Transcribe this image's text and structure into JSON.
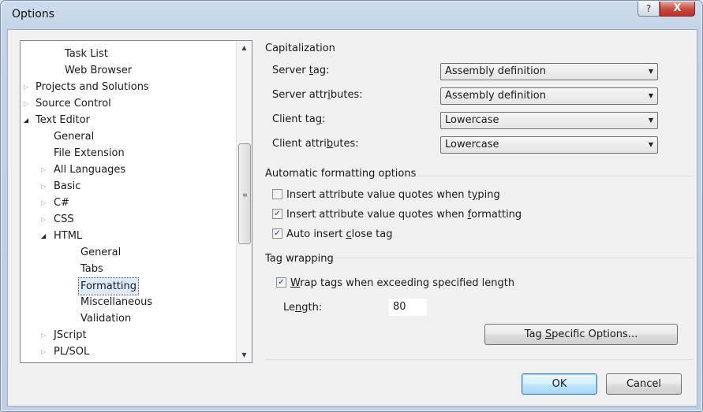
{
  "window": {
    "title": "Options",
    "help_label": "?",
    "close_label": "X"
  },
  "tree": {
    "items": [
      {
        "label": "Task List",
        "level": 2,
        "expander": ""
      },
      {
        "label": "Web Browser",
        "level": 2,
        "expander": ""
      },
      {
        "label": "Projects and Solutions",
        "level": 0,
        "expander": "collapsed"
      },
      {
        "label": "Source Control",
        "level": 0,
        "expander": "collapsed"
      },
      {
        "label": "Text Editor",
        "level": 0,
        "expander": "expanded"
      },
      {
        "label": "General",
        "level": 1,
        "expander": ""
      },
      {
        "label": "File Extension",
        "level": 1,
        "expander": ""
      },
      {
        "label": "All Languages",
        "level": 1,
        "expander": "collapsed"
      },
      {
        "label": "Basic",
        "level": 1,
        "expander": "collapsed"
      },
      {
        "label": "C#",
        "level": 1,
        "expander": "collapsed"
      },
      {
        "label": "CSS",
        "level": 1,
        "expander": "collapsed"
      },
      {
        "label": "HTML",
        "level": 1,
        "expander": "expanded"
      },
      {
        "label": "General",
        "level": 2,
        "expander": ""
      },
      {
        "label": "Tabs",
        "level": 2,
        "expander": ""
      },
      {
        "label": "Formatting",
        "level": 2,
        "expander": "",
        "selected": true
      },
      {
        "label": "Miscellaneous",
        "level": 2,
        "expander": ""
      },
      {
        "label": "Validation",
        "level": 2,
        "expander": ""
      },
      {
        "label": "JScript",
        "level": 1,
        "expander": "collapsed"
      },
      {
        "label": "PL/SOL",
        "level": 1,
        "expander": "collapsed"
      }
    ]
  },
  "capitalization": {
    "title": "Capitalization",
    "rows": [
      {
        "label_pre": "Server ",
        "label_u": "t",
        "label_post": "ag:",
        "value": "Assembly definition"
      },
      {
        "label_pre": "Server attr",
        "label_u": "i",
        "label_post": "butes:",
        "value": "Assembly definition"
      },
      {
        "label_pre": "Client ta",
        "label_u": "g",
        "label_post": ":",
        "value": "Lowercase"
      },
      {
        "label_pre": "Client attri",
        "label_u": "b",
        "label_post": "utes:",
        "value": "Lowercase"
      }
    ]
  },
  "auto_format": {
    "title": "Automatic formatting options",
    "options": [
      {
        "pre": "Insert attribute value quotes when t",
        "u": "y",
        "post": "ping",
        "checked": false
      },
      {
        "pre": "Insert attribute value quotes when ",
        "u": "f",
        "post": "ormatting",
        "checked": true
      },
      {
        "pre": "Auto insert ",
        "u": "c",
        "post": "lose tag",
        "checked": true
      }
    ]
  },
  "tag_wrapping": {
    "title": "Tag wrapping",
    "wrap": {
      "pre": "",
      "u": "W",
      "post": "rap tags when exceeding specified length",
      "checked": true
    },
    "length_pre": "Le",
    "length_u": "n",
    "length_post": "gth:",
    "length_value": "80",
    "specific_pre": "Tag ",
    "specific_u": "S",
    "specific_post": "pecific Options..."
  },
  "footer": {
    "ok_label": "OK",
    "cancel_label": "Cancel"
  },
  "icons": {
    "collapsed": "triangle-right",
    "expanded": "triangle-down-filled",
    "checkmark": "check",
    "dropdown": "triangle-down"
  }
}
